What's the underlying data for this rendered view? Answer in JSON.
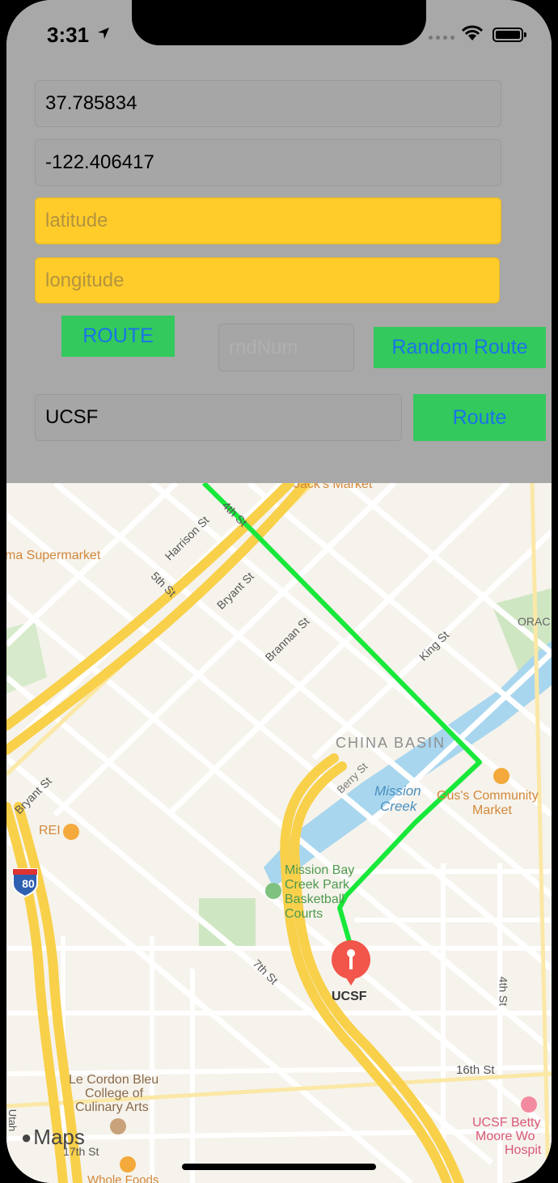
{
  "status_bar": {
    "time": "3:31"
  },
  "form": {
    "latitude_value": "37.785834",
    "longitude_value": "-122.406417",
    "dest_latitude_placeholder": "latitude",
    "dest_longitude_placeholder": "longitude",
    "route_button": "ROUTE",
    "rnd_placeholder": "rndNum",
    "random_route_button": "Random Route",
    "destination_value": "UCSF",
    "route_button_2": "Route"
  },
  "map": {
    "streets": {
      "harrison": "Harrison St",
      "fourth": "4th St",
      "fifth": "5th St",
      "bryant_top": "Bryant St",
      "brannan": "Brannan St",
      "king": "King St",
      "berry": "Berry St",
      "bryant_left": "Bryant St",
      "seventh": "7th St",
      "fourth_right": "4th St",
      "sixteenth": "16th St",
      "seventeenth": "17th St"
    },
    "places": {
      "jacks": "Jack's Market",
      "supermarket": "ma Supermarket",
      "oracle": "ORAC",
      "china_basin": "CHINA BASIN",
      "mission_creek_1": "Mission",
      "mission_creek_2": "Creek",
      "gus_1": "Gus's Community",
      "gus_2": "Market",
      "rei": "REI",
      "park_1": "Mission Bay",
      "park_2": "Creek Park",
      "park_3": "Basketball",
      "park_4": "Courts",
      "ucsf": "UCSF",
      "cordon_1": "Le Cordon Bleu",
      "cordon_2": "College of",
      "cordon_3": "Culinary Arts",
      "betty_1": "UCSF Betty",
      "betty_2": "Moore Wo",
      "betty_3": "Hospit",
      "whole": "Whole Foods",
      "utah": "Utah"
    },
    "highway_shield": "80",
    "attribution": "Maps",
    "colors": {
      "route": "#18e83a",
      "highway": "#f8d04a",
      "water": "#a8d6ee",
      "park": "#cfe6c2",
      "pin": "#f2554a"
    }
  }
}
